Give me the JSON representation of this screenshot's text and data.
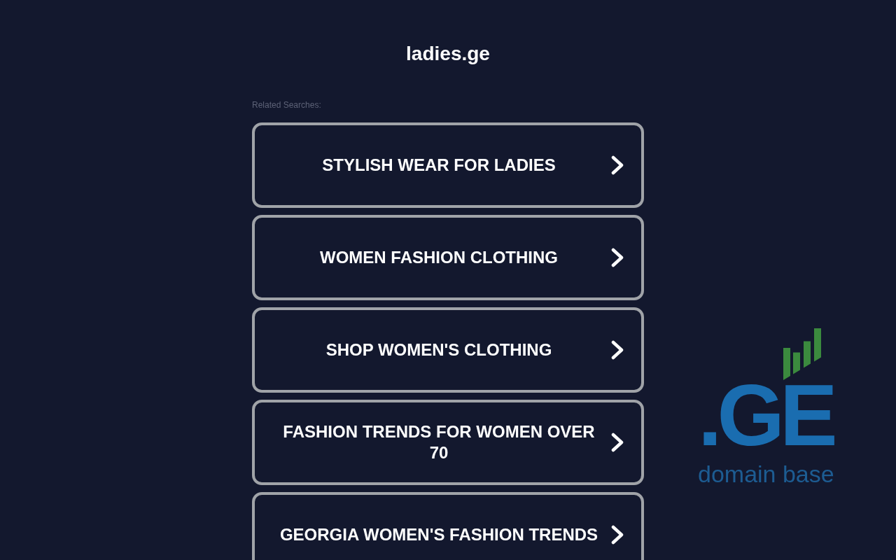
{
  "header": {
    "title": "ladies.ge"
  },
  "related_searches": {
    "label": "Related Searches:",
    "links": [
      {
        "text": "STYLISH WEAR FOR LADIES"
      },
      {
        "text": "WOMEN FASHION CLOTHING"
      },
      {
        "text": "SHOP WOMEN'S CLOTHING"
      },
      {
        "text": "FASHION TRENDS FOR WOMEN OVER 70"
      },
      {
        "text": "GEORGIA WOMEN'S FASHION TRENDS"
      }
    ]
  },
  "logo": {
    "wordmark": ".GE",
    "tagline": "domain base"
  }
}
